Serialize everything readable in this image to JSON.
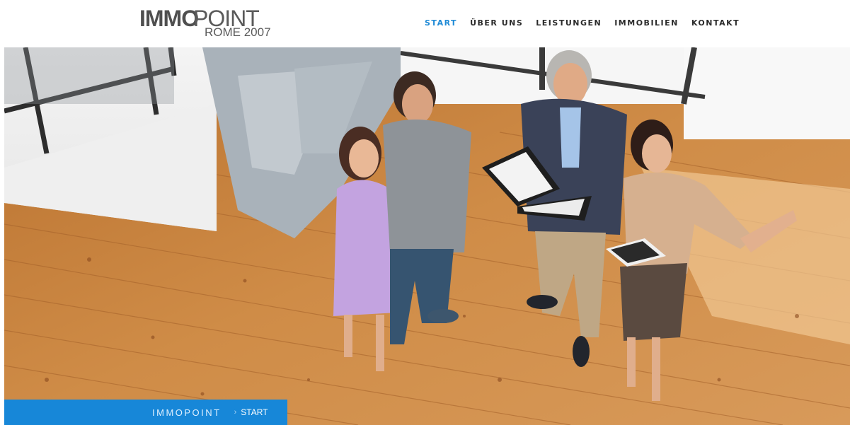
{
  "logo": {
    "bold": "IMMO",
    "light": "POINT",
    "sub": "ROME 2007"
  },
  "nav": {
    "items": [
      {
        "label": "START",
        "active": true
      },
      {
        "label": "ÜBER UNS",
        "active": false
      },
      {
        "label": "LEISTUNGEN",
        "active": false
      },
      {
        "label": "IMMOBILIEN",
        "active": false
      },
      {
        "label": "KONTAKT",
        "active": false
      }
    ]
  },
  "breadcrumb": {
    "home": "IMMOPOINT",
    "separator": "›",
    "current": "START"
  },
  "colors": {
    "accent": "#1e8ad6",
    "breadcrumb_bg": "#1787d8",
    "floor": "#c7833d"
  }
}
